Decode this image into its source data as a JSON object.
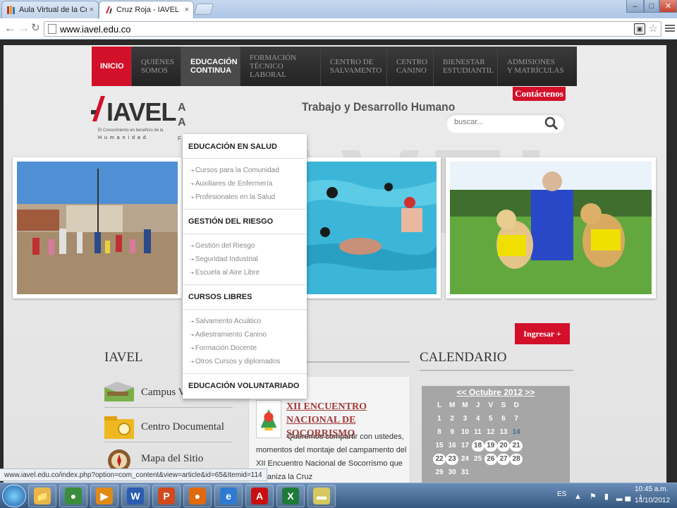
{
  "browser": {
    "tabs": [
      {
        "title": "Aula Virtual de la Cruz Roja",
        "close": "×",
        "active": false
      },
      {
        "title": "Cruz Roja - IAVEL",
        "close": "×",
        "active": true
      }
    ],
    "url": "www.iavel.edu.co",
    "window_buttons": [
      "–",
      "□",
      "✕"
    ],
    "status_url": "www.iavel.edu.co/index.php?option=com_content&view=article&id=65&Itemid=114"
  },
  "site": {
    "menu": [
      {
        "label": "INICIO"
      },
      {
        "label": "QUIÉNES\nSOMOS"
      },
      {
        "label": "EDUCACIÓN\nCONTINUA"
      },
      {
        "label": "FORMACIÓN\nTÉCNICO LABORAL"
      },
      {
        "label": "CENTRO DE\nSALVAMENTO"
      },
      {
        "label": "CENTRO\nCANINO"
      },
      {
        "label": "BIENESTAR\nESTUDIANTIL"
      },
      {
        "label": "ADMISIONES\nY MATRÍCULAS"
      }
    ],
    "contact_label": "Contáctenos",
    "logo": {
      "word": "IAVEL",
      "tagline": "El Conocimiento en beneficio de la",
      "tagline2": "Humanidad"
    },
    "headline": "Trabajo y Desarrollo Humano",
    "headline_fragments": [
      "A",
      "A",
      "F"
    ],
    "search_placeholder": "buscar...",
    "ingresar_label": "Ingresar +",
    "watermark": "IAVEL",
    "left": {
      "title": "IAVEL",
      "links": [
        {
          "label": "Campus Virtual",
          "icon": "campus-icon"
        },
        {
          "label": "Centro Documental",
          "icon": "folder-icon"
        },
        {
          "label": "Mapa del Sitio",
          "icon": "compass-icon"
        }
      ]
    },
    "news": {
      "title": "XII ENCUENTRO NACIONAL DE SOCORRISMO",
      "body": "Queremos compartir con ustedes, momentos del montaje del campamento del XII Encuentro Nacional de Socorrismo que organiza la Cruz"
    },
    "calendar": {
      "title": "CALENDARIO",
      "month": "<< Octubre 2012 >>",
      "dow": [
        "L",
        "M",
        "M",
        "J",
        "V",
        "S",
        "D"
      ],
      "weeks": [
        [
          "1",
          "2",
          "3",
          "4",
          "5",
          "6",
          "7"
        ],
        [
          "8",
          "9",
          "10",
          "11",
          "12",
          "13",
          "14"
        ],
        [
          "15",
          "16",
          "17",
          "18",
          "19",
          "20",
          "21"
        ],
        [
          "22",
          "23",
          "24",
          "25",
          "26",
          "27",
          "28"
        ],
        [
          "29",
          "30",
          "31",
          "",
          "",
          "",
          ""
        ]
      ],
      "today": "14",
      "event_days": [
        "18",
        "19",
        "20",
        "21",
        "22",
        "23",
        "26",
        "27",
        "28"
      ]
    },
    "dropdown": [
      {
        "heading": "EDUCACIÓN EN SALUD",
        "items": [
          "Cursos para la Comunidad",
          "Auxiliares de Enfermería",
          "Profesionales en la Salud"
        ]
      },
      {
        "heading": "GESTIÓN DEL RIESGO",
        "items": [
          "Gestión del Riesgo",
          "Seguridad Industrial",
          "Escuela al Aire Libre"
        ]
      },
      {
        "heading": "CURSOS LIBRES",
        "items": [
          "Salvamento Acuático",
          "Adiestramiento Canino",
          "Formación Docente",
          "Otros Cursos y diplomados"
        ]
      },
      {
        "heading": "EDUCACIÓN VOLUNTARIADO",
        "items": []
      }
    ]
  },
  "taskbar": {
    "apps": [
      {
        "name": "explorer",
        "glyph": "📁",
        "color": "#e8b64a"
      },
      {
        "name": "chrome",
        "glyph": "●",
        "color": "#3a8d3a"
      },
      {
        "name": "media",
        "glyph": "▶",
        "color": "#e08a18"
      },
      {
        "name": "word",
        "glyph": "W",
        "color": "#2a5db0"
      },
      {
        "name": "powerpoint",
        "glyph": "P",
        "color": "#d04a1e"
      },
      {
        "name": "firefox",
        "glyph": "●",
        "color": "#e06a10"
      },
      {
        "name": "ie",
        "glyph": "e",
        "color": "#2d7ad0"
      },
      {
        "name": "acrobat",
        "glyph": "A",
        "color": "#c81010"
      },
      {
        "name": "excel",
        "glyph": "X",
        "color": "#1e7a3a"
      },
      {
        "name": "notes",
        "glyph": "▬",
        "color": "#d6c860"
      }
    ],
    "lang": "ES",
    "time": "10:45 a.m.",
    "date": "14/10/2012"
  }
}
